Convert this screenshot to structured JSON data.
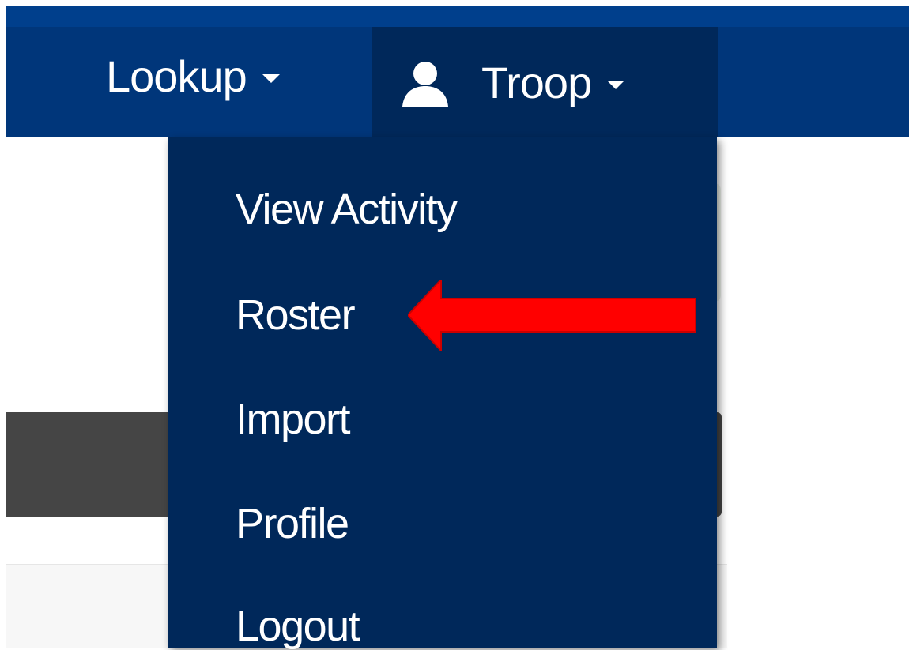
{
  "navbar": {
    "lookup_label": "Lookup",
    "troop_label": "Troop",
    "icons": {
      "lookup_caret": "chevron-down-icon",
      "troop_user": "user-icon",
      "troop_caret": "chevron-down-icon"
    }
  },
  "dropdown": {
    "items": [
      {
        "label": "View Activity"
      },
      {
        "label": "Roster"
      },
      {
        "label": "Import"
      },
      {
        "label": "Profile"
      },
      {
        "label": "Logout"
      }
    ]
  },
  "annotation": {
    "target": "Roster",
    "color": "#ff0000"
  },
  "colors": {
    "navbar": "#00367a",
    "dropdown": "#00285a",
    "text": "#ffffff"
  }
}
